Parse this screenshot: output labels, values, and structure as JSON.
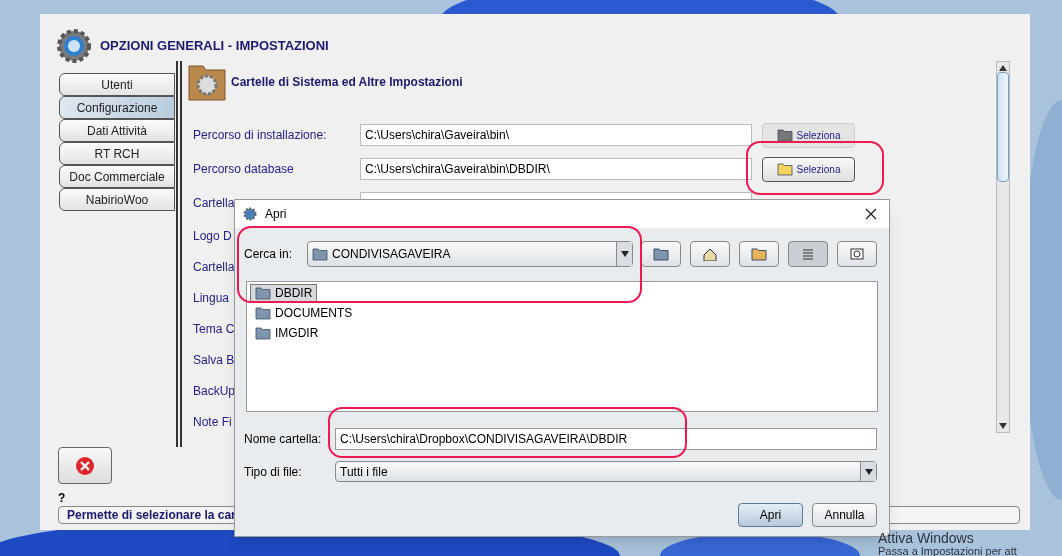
{
  "window": {
    "title": "OPZIONI GENERALI - IMPOSTAZIONI"
  },
  "tabs": [
    {
      "label": "Utenti",
      "selected": false
    },
    {
      "label": "Configurazione",
      "selected": true
    },
    {
      "label": "Dati Attività",
      "selected": false
    },
    {
      "label": "RT RCH",
      "selected": false
    },
    {
      "label": "Doc Commerciale",
      "selected": false
    },
    {
      "label": "NabirioWoo",
      "selected": false
    }
  ],
  "section": {
    "title": "Cartelle di Sistema ed Altre Impostazioni"
  },
  "settings": [
    {
      "label": "Percorso di installazione:",
      "value": "C:\\Users\\chira\\Gaveira\\bin\\",
      "button": "Seleziona",
      "disabled": true
    },
    {
      "label": "Percorso database",
      "value": "C:\\Users\\chira\\Gaveira\\bin\\DBDIR\\",
      "button": "Seleziona",
      "disabled": false
    },
    {
      "label": "Cartella"
    },
    {
      "label": "Logo D"
    },
    {
      "label": "Cartella"
    },
    {
      "label": "Lingua"
    },
    {
      "label": "Tema C"
    },
    {
      "label": "Salva B"
    },
    {
      "label": "BackUp"
    },
    {
      "label": "Note Fi"
    }
  ],
  "help": {
    "mark": "?",
    "text": "Permette di selezionare la car"
  },
  "dialog": {
    "title": "Apri",
    "look_in_label": "Cerca in:",
    "look_in_value": "CONDIVISAGAVEIRA",
    "files": [
      {
        "name": "DBDIR",
        "selected": true
      },
      {
        "name": "DOCUMENTS",
        "selected": false
      },
      {
        "name": "IMGDIR",
        "selected": false
      }
    ],
    "name_label": "Nome cartella:",
    "name_value": "C:\\Users\\chira\\Dropbox\\CONDIVISAGAVEIRA\\DBDIR",
    "type_label": "Tipo di file:",
    "type_value": "Tutti i file",
    "buttons": [
      "Apri",
      "Annulla"
    ]
  },
  "os_notice": {
    "title": "Attiva Windows",
    "text": "Passa a Impostazioni per att"
  }
}
